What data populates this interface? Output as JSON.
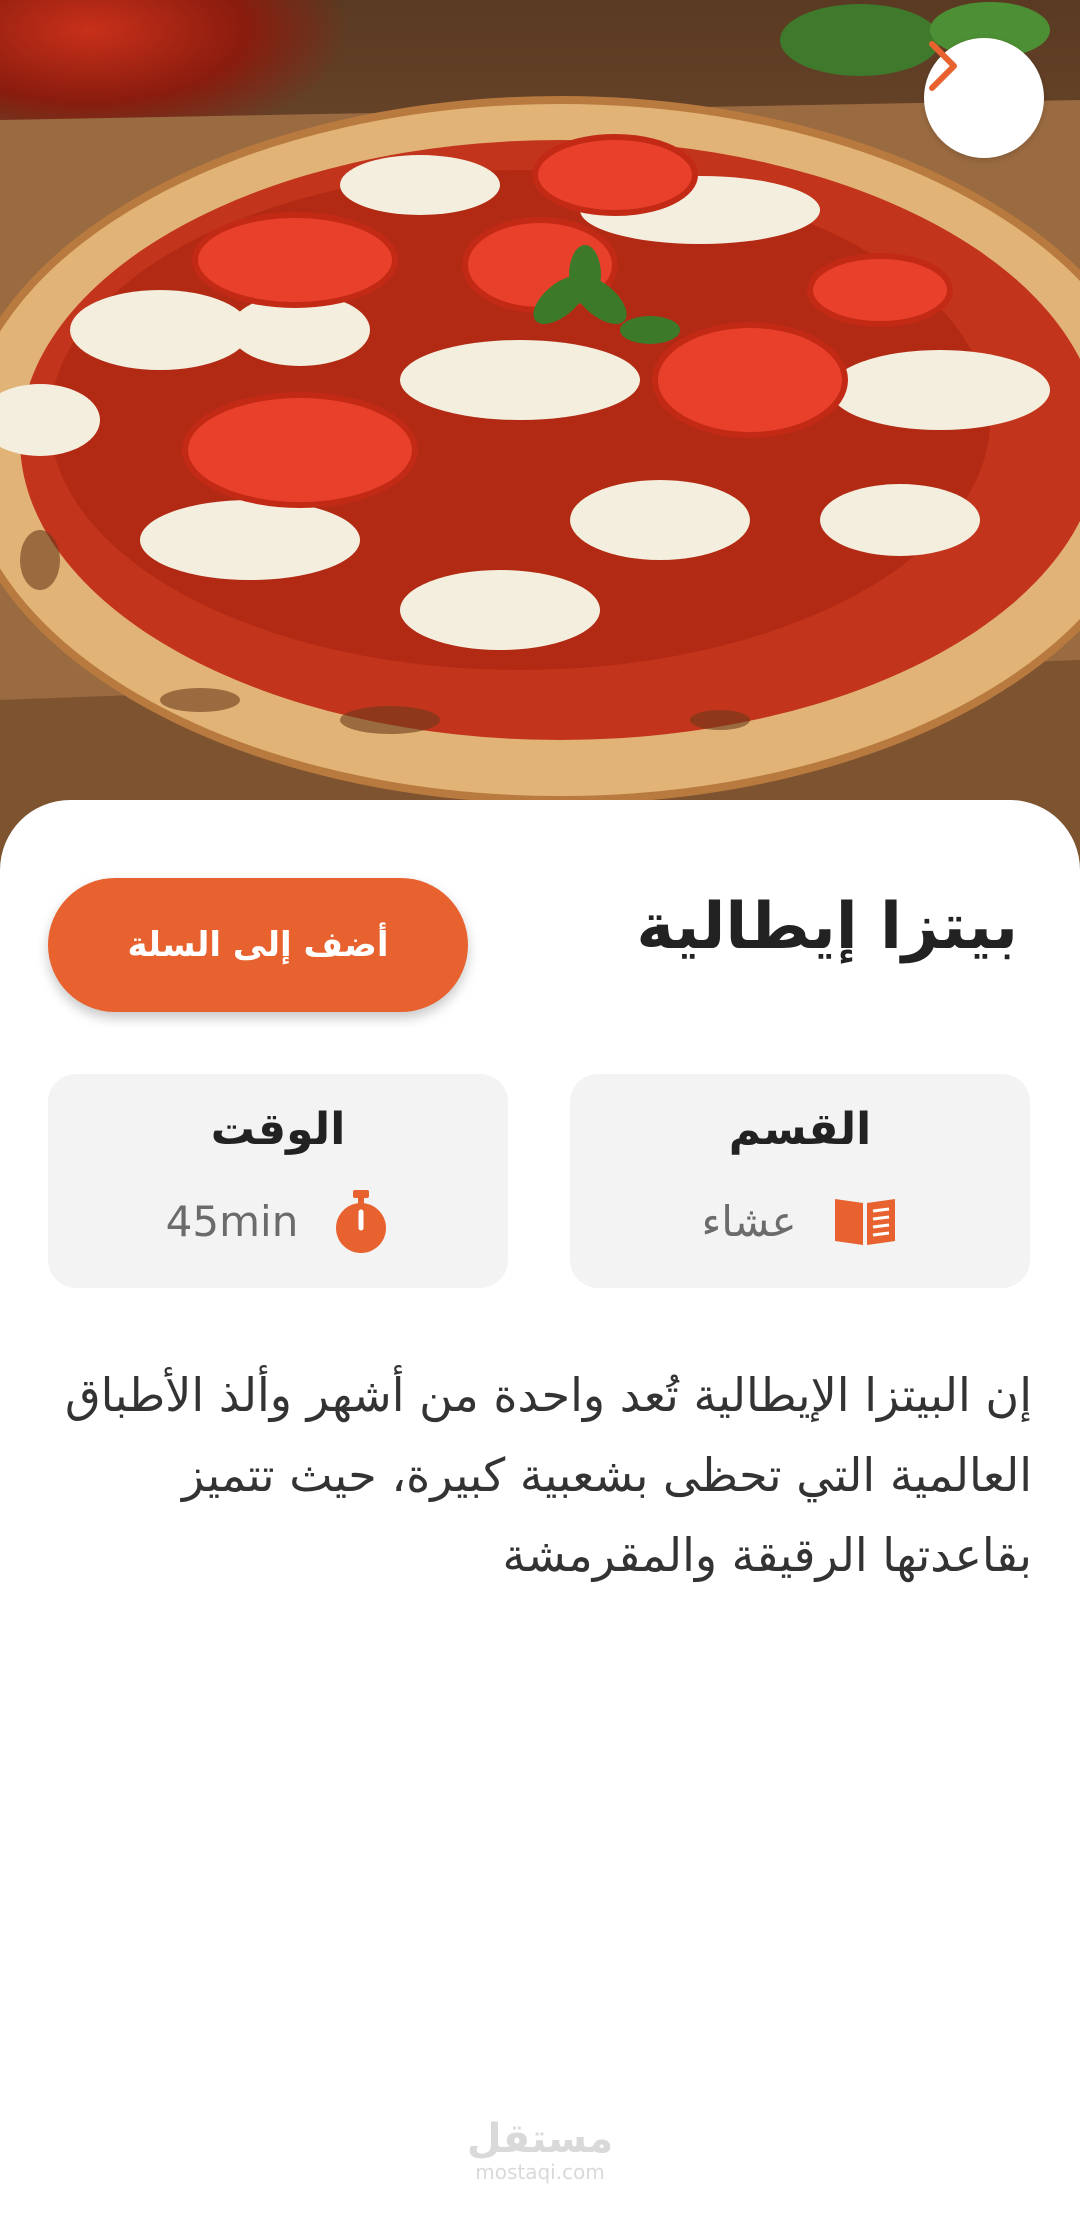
{
  "hero": {
    "image": "pizza-margherita-photo"
  },
  "header": {
    "back_icon": "chevron-right-icon"
  },
  "recipe": {
    "title": "بيتزا إيطالية",
    "add_to_cart_label": "أضف إلى السلة",
    "description": "إن البيتزا الإيطالية تُعد واحدة من أشهر وألذ الأطباق العالمية التي تحظى بشعبية كبيرة، حيث تتميز بقاعدتها الرقيقة والمقرمشة"
  },
  "info_cards": {
    "category": {
      "label": "القسم",
      "value": "عشاء",
      "icon": "book-icon"
    },
    "time": {
      "label": "الوقت",
      "value": "45min",
      "icon": "timer-icon"
    }
  },
  "watermark": {
    "text_ar": "مستقل",
    "text_en": "mostaqi.com"
  },
  "colors": {
    "accent": "#e7622f",
    "card_bg": "#f3f3f3",
    "title": "#222222",
    "muted": "#6b6b6b"
  }
}
